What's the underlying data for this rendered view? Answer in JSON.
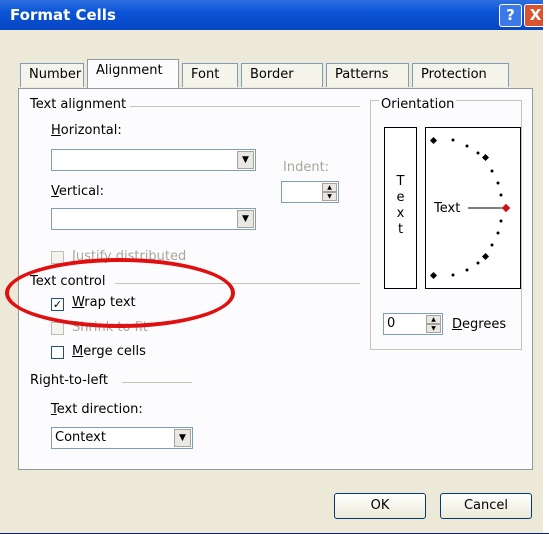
{
  "window": {
    "title": "Format Cells",
    "help_glyph": "?",
    "close_glyph": "X"
  },
  "tabs": [
    "Number",
    "Alignment",
    "Font",
    "Border",
    "Patterns",
    "Protection"
  ],
  "active_tab": "Alignment",
  "text_alignment": {
    "group_label": "Text alignment",
    "horizontal_label": "Horizontal:",
    "horizontal_value": "",
    "vertical_label": "Vertical:",
    "vertical_value": "",
    "indent_label": "Indent:",
    "indent_value": "",
    "justify_distributed_label": "Justify distributed"
  },
  "text_control": {
    "group_label": "Text control",
    "wrap_text_label": "Wrap text",
    "wrap_text_checked": true,
    "shrink_to_fit_label": "Shrink to fit",
    "merge_cells_label": "Merge cells",
    "merge_cells_checked": false
  },
  "rtl": {
    "group_label": "Right-to-left",
    "direction_label": "Text direction:",
    "direction_value": "Context"
  },
  "orientation": {
    "group_label": "Orientation",
    "vertical_letters": [
      "T",
      "e",
      "x",
      "t"
    ],
    "dial_text": "Text",
    "degrees_value": "0",
    "degrees_label": "Degrees"
  },
  "buttons": {
    "ok": "OK",
    "cancel": "Cancel"
  },
  "colors": {
    "annotation": "#e01010",
    "titlebar": "#0a54d6",
    "pointer": "#d01010"
  }
}
